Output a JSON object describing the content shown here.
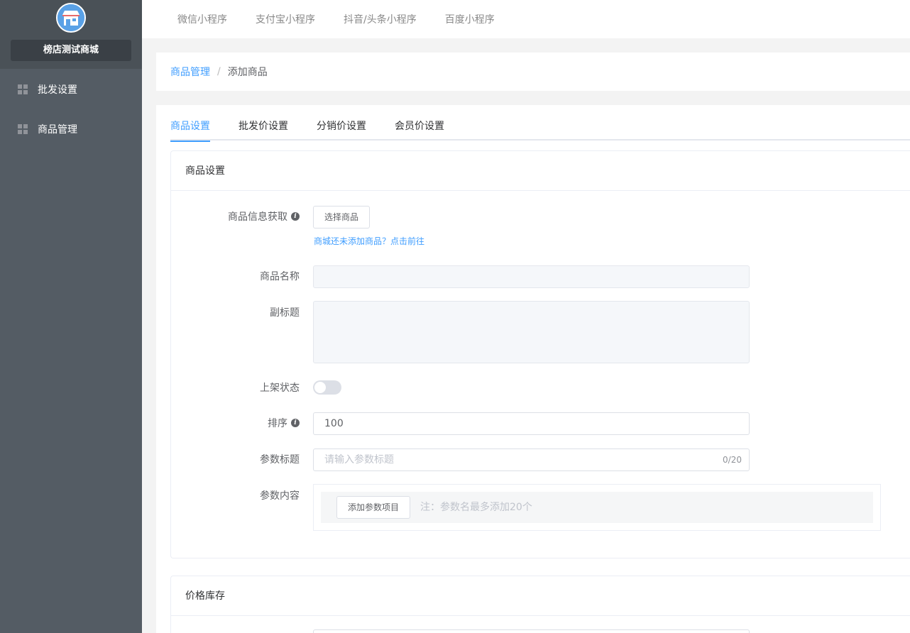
{
  "sidebar": {
    "shop_name": "榜店测试商城",
    "items": [
      {
        "label": "批发设置",
        "icon": "grid-icon"
      },
      {
        "label": "商品管理",
        "icon": "grid-icon"
      }
    ]
  },
  "topnav": {
    "items": [
      "微信小程序",
      "支付宝小程序",
      "抖音/头条小程序",
      "百度小程序"
    ]
  },
  "breadcrumb": {
    "parent": "商品管理",
    "separator": "/",
    "current": "添加商品"
  },
  "tabs": [
    "商品设置",
    "批发价设置",
    "分销价设置",
    "会员价设置"
  ],
  "active_tab": 0,
  "panel_goods": {
    "title": "商品设置",
    "fetch": {
      "label": "商品信息获取",
      "button": "选择商品",
      "hint": "商城还未添加商品？点击前往"
    },
    "name": {
      "label": "商品名称",
      "value": ""
    },
    "subtitle": {
      "label": "副标题",
      "value": ""
    },
    "status": {
      "label": "上架状态",
      "on": false
    },
    "sort": {
      "label": "排序",
      "value": "100"
    },
    "param_title": {
      "label": "参数标题",
      "placeholder": "请输入参数标题",
      "counter": "0/20"
    },
    "param_content": {
      "label": "参数内容",
      "button": "添加参数项目",
      "note": "注：参数名最多添加20个"
    }
  },
  "panel_price": {
    "title": "价格库存"
  },
  "colors": {
    "sidebar_bg": "#545c64",
    "primary": "#409eff"
  }
}
